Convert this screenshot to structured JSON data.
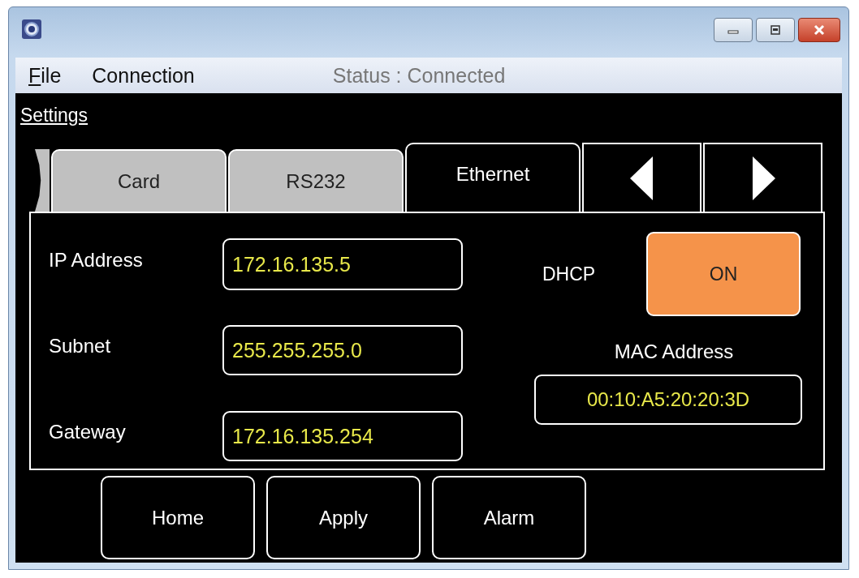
{
  "menu": [
    {
      "label": "File",
      "underline_first": true
    },
    {
      "label": "Connection",
      "underline_first": false
    }
  ],
  "status": "Status : Connected",
  "section_link": "Settings",
  "tabs": [
    {
      "label": "Card",
      "selected": false
    },
    {
      "label": "RS232",
      "selected": false
    },
    {
      "label": "Ethernet",
      "selected": true
    }
  ],
  "fields": [
    {
      "label": "IP Address",
      "value": "172.16.135.5"
    },
    {
      "label": "Subnet",
      "value": "255.255.255.0"
    },
    {
      "label": "Gateway",
      "value": "172.16.135.254"
    }
  ],
  "dhcp": {
    "label": "DHCP",
    "text": "ON",
    "on": true
  },
  "mac": {
    "label": "MAC Address",
    "value": "00:10:A5:20:20:3D"
  },
  "buttons": [
    "Home",
    "Apply",
    "Alarm"
  ]
}
